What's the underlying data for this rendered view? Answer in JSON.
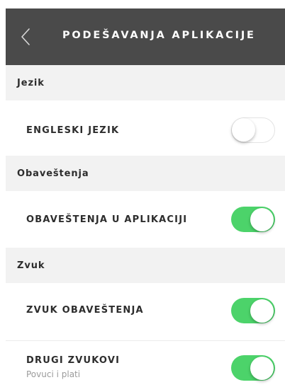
{
  "header": {
    "title": "PODEŠAVANJA APLIKACIJE",
    "back_icon": "chevron-left-icon"
  },
  "sections": [
    {
      "title": "Jezik",
      "items": [
        {
          "label": "ENGLESKI JEZIK",
          "sublabel": "",
          "enabled": false
        }
      ]
    },
    {
      "title": "Obaveštenja",
      "items": [
        {
          "label": "OBAVEŠTENJA U APLIKACIJI",
          "sublabel": "",
          "enabled": true
        }
      ]
    },
    {
      "title": "Zvuk",
      "items": [
        {
          "label": "ZVUK OBAVEŠTENJA",
          "sublabel": "",
          "enabled": true
        },
        {
          "label": "DRUGI ZVUKOVI",
          "sublabel": "Povuci i plati",
          "enabled": true
        }
      ]
    }
  ],
  "colors": {
    "header_bg": "#4a4a4a",
    "section_bg": "#f2f2f2",
    "toggle_on": "#4cd36a",
    "toggle_off_border": "#e3e3e3"
  }
}
